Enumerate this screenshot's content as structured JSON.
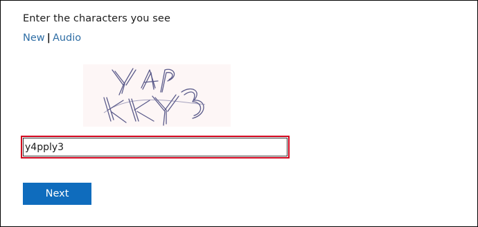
{
  "prompt": "Enter the characters you see",
  "links": {
    "new_label": "New",
    "separator": "|",
    "audio_label": "Audio"
  },
  "captcha": {
    "line1": "Y4P",
    "line2": "KKY3",
    "background_color": "#fdf6f6"
  },
  "input": {
    "value": "y4pply3",
    "highlight_color": "#d0021b"
  },
  "next_button": {
    "label": "Next",
    "color": "#0f6cbd"
  }
}
